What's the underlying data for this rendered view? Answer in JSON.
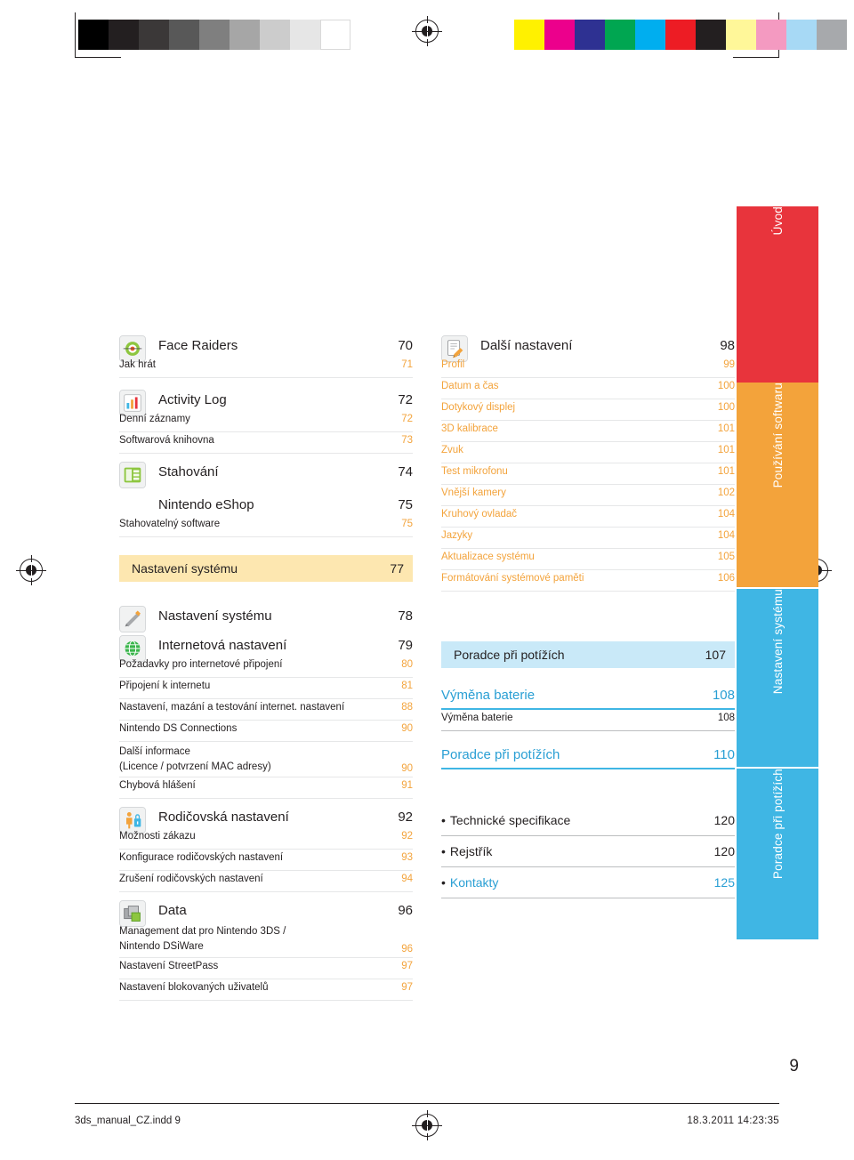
{
  "page": {
    "folio": "9",
    "footer_left": "3ds_manual_CZ.indd   9",
    "footer_right": "18.3.2011   14:23:35"
  },
  "tabs": [
    {
      "name": "uvod",
      "label": "Úvod",
      "color": "#e8343c"
    },
    {
      "name": "pouzivani-softwaru",
      "label": "Používání softwaru",
      "color": "#f3a33b"
    },
    {
      "name": "nastaveni-systemu",
      "label": "Nastavení systému",
      "color": "#3fb6e4"
    },
    {
      "name": "poradce-pri-potizich",
      "label": "Poradce při potížích",
      "color": "#3fb6e4"
    }
  ],
  "swatches": {
    "gray_strip": [
      "#000000",
      "#231f20",
      "#3b3838",
      "#585858",
      "#7f7f7f",
      "#a6a6a6",
      "#cccccc",
      "#e6e6e6",
      "#ffffff"
    ],
    "color_strip": [
      "#fff100",
      "#ec008c",
      "#2e3192",
      "#00a651",
      "#00aeef",
      "#ed1c24",
      "#231f20",
      "#fff799",
      "#f49ac1",
      "#a7d9f5",
      "#a7a9ac"
    ]
  },
  "toc": {
    "left_column": [
      {
        "type": "icon-entry",
        "icon": "face-raiders-icon",
        "label": "Face Raiders",
        "page": "70",
        "subs": [
          {
            "label": "Jak hrát",
            "page": "71"
          }
        ]
      },
      {
        "type": "icon-entry",
        "icon": "activity-log-icon",
        "label": "Activity Log",
        "page": "72",
        "subs": [
          {
            "label": "Denní záznamy",
            "page": "72"
          },
          {
            "label": "Softwarová knihovna",
            "page": "73"
          }
        ]
      },
      {
        "type": "icon-entry",
        "icon": "download-icon",
        "label": "Stahování",
        "page": "74",
        "subs": []
      },
      {
        "type": "entry",
        "label": "Nintendo eShop",
        "page": "75",
        "subs": [
          {
            "label": "Stahovatelný software",
            "page": "75"
          }
        ]
      },
      {
        "type": "bar",
        "label": "Nastavení systému",
        "page": "77"
      },
      {
        "type": "icon-entry",
        "icon": "system-settings-icon",
        "label": "Nastavení systému",
        "page": "78",
        "subs": []
      },
      {
        "type": "icon-entry",
        "icon": "internet-settings-icon",
        "label": "Internetová nastavení",
        "page": "79",
        "subs": [
          {
            "label": "Požadavky pro internetové připojení",
            "page": "80"
          },
          {
            "label": "Připojení k internetu",
            "page": "81"
          },
          {
            "label": "Nastavení, mazání a testování internet. nastavení",
            "page": "88"
          },
          {
            "label": "Nintendo DS Connections",
            "page": "90"
          },
          {
            "label": "Další informace\n(Licence / potvrzení MAC adresy)",
            "page": "90"
          },
          {
            "label": "Chybová hlášení",
            "page": "91"
          }
        ]
      },
      {
        "type": "icon-entry",
        "icon": "parental-controls-icon",
        "label": "Rodičovská nastavení",
        "page": "92",
        "subs": [
          {
            "label": "Možnosti zákazu",
            "page": "92"
          },
          {
            "label": "Konfigurace rodičovských nastavení",
            "page": "93"
          },
          {
            "label": "Zrušení rodičovských nastavení",
            "page": "94"
          }
        ]
      },
      {
        "type": "icon-entry",
        "icon": "data-management-icon",
        "label": "Data",
        "page": "96",
        "subs": [
          {
            "label": "Management dat pro Nintendo 3DS /\nNintendo DSiWare",
            "page": "96"
          },
          {
            "label": "Nastavení StreetPass",
            "page": "97"
          },
          {
            "label": "Nastavení blokovaných uživatelů",
            "page": "97"
          }
        ]
      }
    ],
    "right_column": [
      {
        "type": "icon-entry",
        "icon": "other-settings-icon",
        "label": "Další nastavení",
        "page": "98",
        "subs": [
          {
            "label": "Profil",
            "page": "99"
          },
          {
            "label": "Datum a čas",
            "page": "100"
          },
          {
            "label": "Dotykový displej",
            "page": "100"
          },
          {
            "label": "3D kalibrace",
            "page": "101"
          },
          {
            "label": "Zvuk",
            "page": "101"
          },
          {
            "label": "Test mikrofonu",
            "page": "101"
          },
          {
            "label": "Vnější kamery",
            "page": "102"
          },
          {
            "label": "Kruhový ovladač",
            "page": "104"
          },
          {
            "label": "Jazyky",
            "page": "104"
          },
          {
            "label": "Aktualizace systému",
            "page": "105"
          },
          {
            "label": "Formátování systémové paměti",
            "page": "106"
          }
        ]
      },
      {
        "type": "bar-blue",
        "label": "Poradce při potížích",
        "page": "107"
      },
      {
        "type": "blue-entry",
        "label": "Výměna baterie",
        "page": "108",
        "subs": [
          {
            "label": "Výměna baterie",
            "page": "108"
          }
        ]
      },
      {
        "type": "blue-entry",
        "label": "Poradce při potížích",
        "page": "110",
        "subs": []
      },
      {
        "type": "bullets",
        "items": [
          {
            "label": "Technické specifikace",
            "page": "120",
            "accent": false
          },
          {
            "label": "Rejstřík",
            "page": "120",
            "accent": false
          },
          {
            "label": "Kontakty",
            "page": "125",
            "accent": true
          }
        ]
      }
    ]
  }
}
